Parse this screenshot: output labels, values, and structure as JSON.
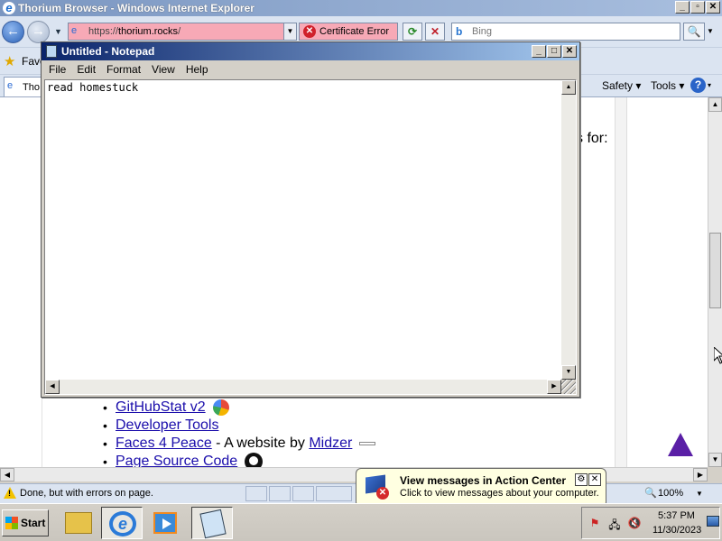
{
  "ie": {
    "title": "Thorium Browser - Windows Internet Explorer",
    "address": {
      "scheme": "https://",
      "host": "thorium.rocks",
      "path": "/"
    },
    "cert_error": "Certificate Error",
    "search_placeholder": "Bing",
    "favorites_label": "Favo",
    "tab_label": "Tho",
    "commands": {
      "safety": "Safety",
      "tools": "Tools"
    },
    "status_text": "Done, but with errors on page.",
    "zoom": "100%"
  },
  "page": {
    "partial_text": "s for:",
    "links": [
      {
        "text": "GitHubStat v2",
        "suffix": "",
        "extra": ""
      },
      {
        "text": "Developer Tools",
        "suffix": "",
        "extra": ""
      },
      {
        "text": "Faces 4 Peace",
        "suffix": " - A website by ",
        "extra": "Midzer"
      },
      {
        "text": "Page Source Code",
        "suffix": "",
        "extra": ""
      }
    ]
  },
  "notepad": {
    "title": "Untitled - Notepad",
    "menu": [
      "File",
      "Edit",
      "Format",
      "View",
      "Help"
    ],
    "content": "read homestuck"
  },
  "balloon": {
    "title": "View messages in Action Center",
    "subtitle": "Click to view messages about your computer."
  },
  "taskbar": {
    "start": "Start",
    "time": "5:37 PM",
    "date": "11/30/2023"
  },
  "colors": {
    "link": "#1a0dab",
    "address_error_bg": "#f7a9b6",
    "triangle": "#5a1fa6"
  }
}
